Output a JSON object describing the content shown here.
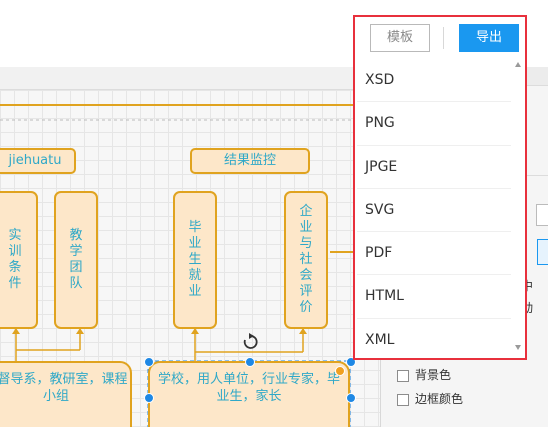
{
  "toolbar": {
    "template_label": "模板",
    "export_label": "导出"
  },
  "export_menu": {
    "items": [
      "XSD",
      "PNG",
      "JPGE",
      "SVG",
      "PDF",
      "HTML",
      "XML"
    ]
  },
  "diagram": {
    "left_label": "jiehuatu",
    "right_label": "结果监控",
    "box_practice": "实训条件",
    "box_teaching": "教学团队",
    "box_employment": "毕业生就业",
    "box_evaluation": "企业与社会评价",
    "bottom_left": "学督导系，教研室，课程小组",
    "bottom_right": "学校，用人单位，行业专家，毕业生，家长"
  },
  "right_panel": {
    "background_color_label": "背景色",
    "border_color_label": "边框颜色",
    "partial_text_1": "中",
    "partial_text_2": "动"
  },
  "colors": {
    "highlight_border": "#e8303c",
    "export_button": "#1a98f0",
    "node_fill": "#fde7c9",
    "node_border": "#e0a31f",
    "node_text": "#2fa8c8",
    "selection_handle": "#1e88e5"
  }
}
